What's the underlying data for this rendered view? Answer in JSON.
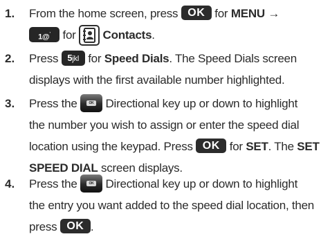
{
  "steps": [
    {
      "num": "1.",
      "l1": {
        "a": "From the home screen, press",
        "b": "for",
        "c": "MENU →"
      },
      "l2": {
        "a": "for",
        "b": "Contacts",
        "c": "."
      }
    },
    {
      "num": "2.",
      "l1": {
        "a": "Press",
        "b": "for",
        "c": "Speed Dials",
        "d": ". The Speed Dials screen"
      },
      "l2": "displays with the first available number highlighted."
    },
    {
      "num": "3.",
      "l1": {
        "a": "Press the",
        "b": "Directional key up or down to highlight"
      },
      "l2": "the number you wish to assign or enter the speed dial",
      "l3": {
        "a": "location using the keypad. Press",
        "b": "for",
        "c": "SET",
        "d": ". The",
        "e": "SET"
      },
      "l4": {
        "a": "SPEED DIAL",
        "b": "screen displays."
      }
    },
    {
      "num": "4.",
      "l1": {
        "a": "Press the",
        "b": "Directional key up or down to highlight"
      },
      "l2": "the entry you want added to the speed dial location, then",
      "l3": {
        "a": "press",
        "b": "."
      }
    }
  ],
  "keys": {
    "ok": "OK",
    "one": "1@",
    "one_suffix": "&#8217;",
    "five": "5",
    "five_suffix": "jkl",
    "nav_small": "OK"
  },
  "icons": {
    "contacts": "contacts-book-icon",
    "nav": "directional-ok-key-icon"
  }
}
